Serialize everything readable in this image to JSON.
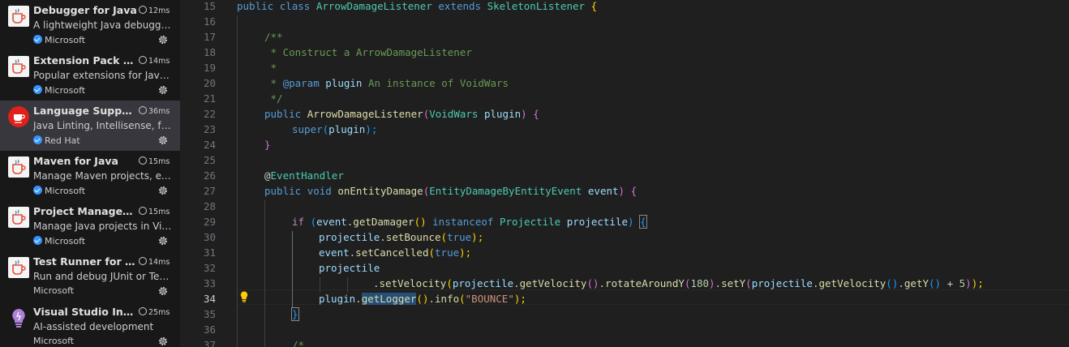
{
  "extensions": [
    {
      "title": "Debugger for Java",
      "time": "12ms",
      "description": "A lightweight Java debugger for Visual Studio Code",
      "publisher": "Microsoft",
      "verified": true,
      "icon": "java-extension-icon"
    },
    {
      "title": "Extension Pack for Java",
      "time": "14ms",
      "description": "Popular extensions for Java development",
      "publisher": "Microsoft",
      "verified": true,
      "icon": "java-extension-icon"
    },
    {
      "title": "Language Support for Java(TM) by Red Hat",
      "time": "36ms",
      "description": "Java Linting, Intellisense, formatting, refactoring",
      "publisher": "Red Hat",
      "verified": true,
      "icon": "redhat-java-icon",
      "selected": true
    },
    {
      "title": "Maven for Java",
      "time": "15ms",
      "description": "Manage Maven projects, execute goals",
      "publisher": "Microsoft",
      "verified": true,
      "icon": "java-extension-icon"
    },
    {
      "title": "Project Manager for Java",
      "time": "15ms",
      "description": "Manage Java projects in Visual Studio Code",
      "publisher": "Microsoft",
      "verified": true,
      "icon": "java-extension-icon"
    },
    {
      "title": "Test Runner for Java",
      "time": "14ms",
      "description": "Run and debug JUnit or TestNG test cases",
      "publisher": "Microsoft",
      "verified": false,
      "icon": "java-extension-icon"
    },
    {
      "title": "Visual Studio IntelliCode",
      "time": "25ms",
      "description": "AI-assisted development",
      "publisher": "Microsoft",
      "verified": false,
      "icon": "intellicode-icon"
    }
  ],
  "editor": {
    "line_numbers": [
      "15",
      "16",
      "17",
      "18",
      "19",
      "20",
      "21",
      "22",
      "23",
      "24",
      "25",
      "26",
      "27",
      "28",
      "29",
      "30",
      "31",
      "32",
      "33",
      "34",
      "35",
      "36",
      "37"
    ],
    "active_line": "34",
    "code": {
      "l15": {
        "t1": "public",
        "t2": " ",
        "t3": "class",
        "t4": " ",
        "t5": "ArrowDamageListener",
        "t6": " ",
        "t7": "extends",
        "t8": " ",
        "t9": "SkeletonListener",
        "t10": " ",
        "t11": "{"
      },
      "l17": {
        "t1": "/**"
      },
      "l18": {
        "t1": " * Construct a ArrowDamageListener"
      },
      "l19": {
        "t1": " *"
      },
      "l20": {
        "t1": " * ",
        "t2": "@param",
        "t3": " ",
        "t4": "plugin",
        "t5": " An instance of VoidWars"
      },
      "l21": {
        "t1": " */"
      },
      "l22": {
        "t1": "public",
        "t2": " ",
        "t3": "ArrowDamageListener",
        "t4": "(",
        "t5": "VoidWars",
        "t6": " ",
        "t7": "plugin",
        "t8": ")",
        "t9": " ",
        "t10": "{"
      },
      "l23": {
        "t1": "super",
        "t2": "(",
        "t3": "plugin",
        "t4": ");"
      },
      "l24": {
        "t1": "}"
      },
      "l26": {
        "t1": "@",
        "t2": "EventHandler"
      },
      "l27": {
        "t1": "public",
        "t2": " ",
        "t3": "void",
        "t4": " ",
        "t5": "onEntityDamage",
        "t6": "(",
        "t7": "EntityDamageByEntityEvent",
        "t8": " ",
        "t9": "event",
        "t10": ")",
        "t11": " ",
        "t12": "{"
      },
      "l29": {
        "t1": "if",
        "t2": " ",
        "t3": "(",
        "t4": "event",
        "t5": ".",
        "t6": "getDamager",
        "t7": "()",
        "t8": " ",
        "t9": "instanceof",
        "t10": " ",
        "t11": "Projectile",
        "t12": " ",
        "t13": "projectile",
        "t14": ")",
        "t15": " ",
        "t16": "{"
      },
      "l30": {
        "t1": "projectile",
        "t2": ".",
        "t3": "setBounce",
        "t4": "(",
        "t5": "true",
        "t6": ");"
      },
      "l31": {
        "t1": "event",
        "t2": ".",
        "t3": "setCancelled",
        "t4": "(",
        "t5": "true",
        "t6": ");"
      },
      "l32": {
        "t1": "projectile"
      },
      "l33": {
        "t1": ".",
        "t2": "setVelocity",
        "t3": "(",
        "t4": "projectile",
        "t5": ".",
        "t6": "getVelocity",
        "t7": "()",
        "t8": ".",
        "t9": "rotateAroundY",
        "t10": "(",
        "t11": "180",
        "t12": ")",
        "t13": ".",
        "t14": "setY",
        "t15": "(",
        "t16": "projectile",
        "t17": ".",
        "t18": "getVelocity",
        "t19": "()",
        "t20": ".",
        "t21": "getY",
        "t22": "()",
        "t23": " + ",
        "t24": "5",
        "t25": ")",
        "t26": ");"
      },
      "l34": {
        "t1": "plugin",
        "t2": ".",
        "t3": "getLogger",
        "t4": "()",
        "t5": ".",
        "t6": "info",
        "t7": "(",
        "t8": "\"BOUNCE\"",
        "t9": ");"
      },
      "l35": {
        "t1": "}"
      },
      "l37": {
        "t1": "/*"
      }
    }
  },
  "colors": {
    "sidebar_bg": "#181818",
    "editor_bg": "#1f1f1f",
    "selected_item_bg": "#37373d",
    "verified_badge": "#3794ff"
  }
}
